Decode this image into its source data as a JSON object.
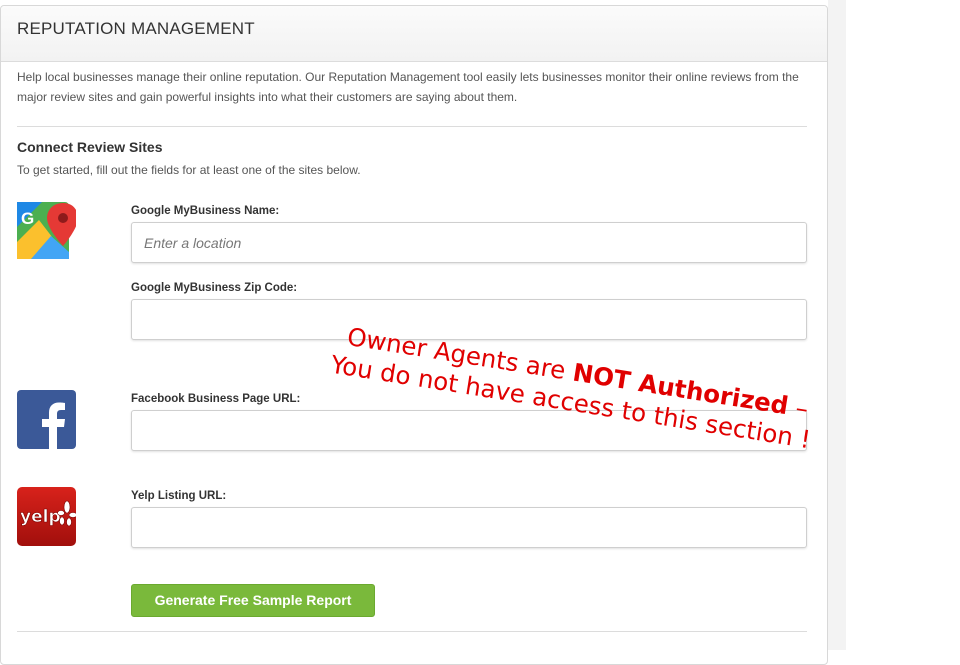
{
  "panel": {
    "title": "REPUTATION MANAGEMENT",
    "intro": "Help local businesses manage their online reputation. Our Reputation Management tool easily lets businesses monitor their online reviews from the major review sites and gain powerful insights into what their customers are saying about them."
  },
  "connect": {
    "title": "Connect Review Sites",
    "subtitle": "To get started, fill out the fields for at least one of the sites below."
  },
  "fields": {
    "google_name": {
      "label": "Google MyBusiness Name:",
      "placeholder": "Enter a location",
      "value": ""
    },
    "google_zip": {
      "label": "Google MyBusiness Zip Code:",
      "placeholder": "",
      "value": ""
    },
    "facebook_url": {
      "label": "Facebook Business Page URL:",
      "placeholder": "",
      "value": ""
    },
    "yelp_url": {
      "label": "Yelp Listing URL:",
      "placeholder": "",
      "value": ""
    }
  },
  "icons": {
    "google": "google-maps-icon",
    "facebook": "facebook-icon",
    "yelp": "yelp-icon",
    "yelp_text": "yelp"
  },
  "actions": {
    "generate_label": "Generate Free Sample Report",
    "generate_color": "#7ab93b"
  },
  "overlay": {
    "line1_prefix": "Owner Agents are ",
    "line1_bold": "NOT Authorized",
    "line1_suffix": " –",
    "line2": "You do not have access to this section !",
    "color": "#e00000"
  }
}
